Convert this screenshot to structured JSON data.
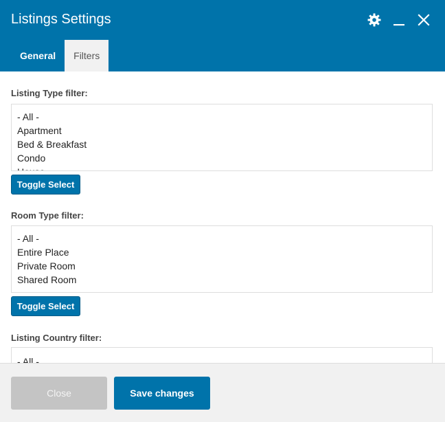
{
  "header": {
    "title": "Listings Settings",
    "icons": [
      "gear-icon",
      "minimize-icon",
      "close-icon"
    ]
  },
  "tabs": [
    {
      "label": "General",
      "active": false
    },
    {
      "label": "Filters",
      "active": true
    }
  ],
  "filters": [
    {
      "label": "Listing Type filter:",
      "options": [
        "- All -",
        "Apartment",
        "Bed & Breakfast",
        "Condo",
        "House"
      ],
      "button": "Toggle Select"
    },
    {
      "label": "Room Type filter:",
      "options": [
        "- All -",
        "Entire Place",
        "Private Room",
        "Shared Room"
      ],
      "button": "Toggle Select"
    },
    {
      "label": "Listing Country filter:",
      "options": [
        "- All -"
      ]
    }
  ],
  "footer": {
    "close_label": "Close",
    "save_label": "Save changes"
  },
  "colors": {
    "accent": "#0073aa",
    "footer_bg": "#f1f1f1",
    "disabled_button": "#c4c4c4"
  }
}
